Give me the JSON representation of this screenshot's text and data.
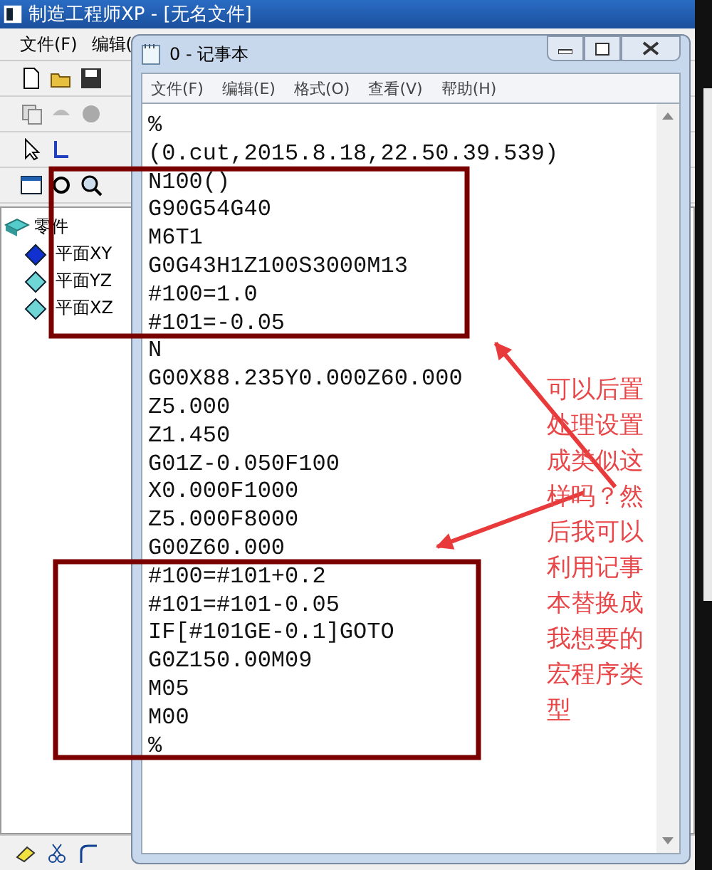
{
  "back_window": {
    "title": "制造工程师XP - [无名文件]",
    "menu": [
      "文件(F)",
      "编辑("
    ],
    "tree": {
      "label": "零件",
      "expanded": true,
      "children": [
        {
          "label": "平面XY",
          "selected": true
        },
        {
          "label": "平面YZ",
          "selected": false
        },
        {
          "label": "平面XZ",
          "selected": false
        }
      ]
    }
  },
  "notepad": {
    "title": "0 - 记事本",
    "menu": [
      "文件(F)",
      "编辑(E)",
      "格式(O)",
      "查看(V)",
      "帮助(H)"
    ],
    "lines": [
      "%",
      "(0.cut,2015.8.18,22.50.39.539)",
      "N100()",
      "G90G54G40",
      "M6T1",
      "G0G43H1Z100S3000M13",
      "#100=1.0",
      "#101=-0.05",
      "N",
      "G00X88.235Y0.000Z60.000",
      "Z5.000",
      "Z1.450",
      "G01Z-0.050F100",
      "X0.000F1000",
      "Z5.000F8000",
      "G00Z60.000",
      "#100=#101+0.2",
      "#101=#101-0.05",
      "IF[#101GE-0.1]GOTO",
      "G0Z150.00M09",
      "M05",
      "M00",
      "%"
    ]
  },
  "annotation": {
    "text": "可以后置处理设置成类似这样吗？然后我可以利用记事本替换成我想要的宏程序类型"
  }
}
